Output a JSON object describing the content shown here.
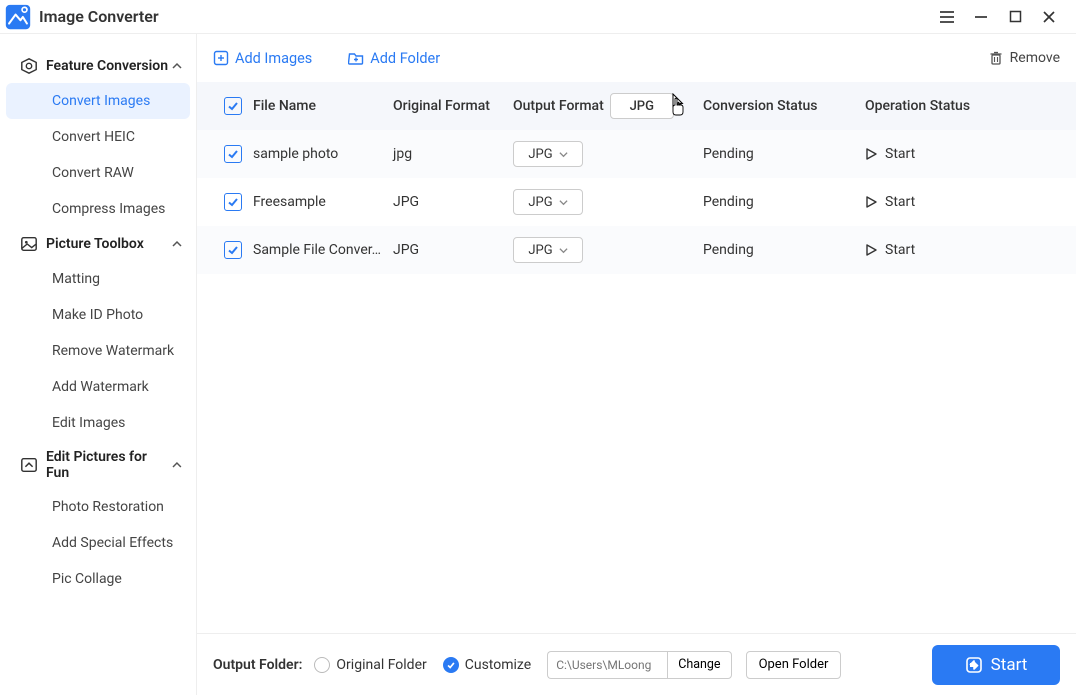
{
  "app": {
    "title": "Image Converter"
  },
  "sidebar": {
    "sections": [
      {
        "label": "Feature Conversion",
        "items": [
          {
            "label": "Convert Images",
            "active": true
          },
          {
            "label": "Convert HEIC"
          },
          {
            "label": "Convert RAW"
          },
          {
            "label": "Compress Images"
          }
        ]
      },
      {
        "label": "Picture Toolbox",
        "items": [
          {
            "label": "Matting"
          },
          {
            "label": "Make ID Photo"
          },
          {
            "label": "Remove Watermark"
          },
          {
            "label": "Add Watermark"
          },
          {
            "label": "Edit Images"
          }
        ]
      },
      {
        "label": "Edit Pictures for Fun",
        "items": [
          {
            "label": "Photo Restoration"
          },
          {
            "label": "Add Special Effects"
          },
          {
            "label": "Pic Collage"
          }
        ]
      }
    ]
  },
  "toolbar": {
    "add_images": "Add Images",
    "add_folder": "Add Folder",
    "remove": "Remove"
  },
  "table": {
    "headers": {
      "file_name": "File Name",
      "original_format": "Original Format",
      "output_format": "Output Format",
      "output_format_value": "JPG",
      "conversion_status": "Conversion Status",
      "operation_status": "Operation Status"
    },
    "rows": [
      {
        "name": "sample photo",
        "orig": "jpg",
        "out": "JPG",
        "status": "Pending",
        "op": "Start"
      },
      {
        "name": "Freesample",
        "orig": "JPG",
        "out": "JPG",
        "status": "Pending",
        "op": "Start"
      },
      {
        "name": "Sample File Conver…",
        "orig": "JPG",
        "out": "JPG",
        "status": "Pending",
        "op": "Start"
      }
    ]
  },
  "footer": {
    "label": "Output Folder:",
    "opt_original": "Original Folder",
    "opt_custom": "Customize",
    "path_placeholder": "C:\\Users\\MLoong",
    "change": "Change",
    "open_folder": "Open Folder",
    "start": "Start"
  }
}
